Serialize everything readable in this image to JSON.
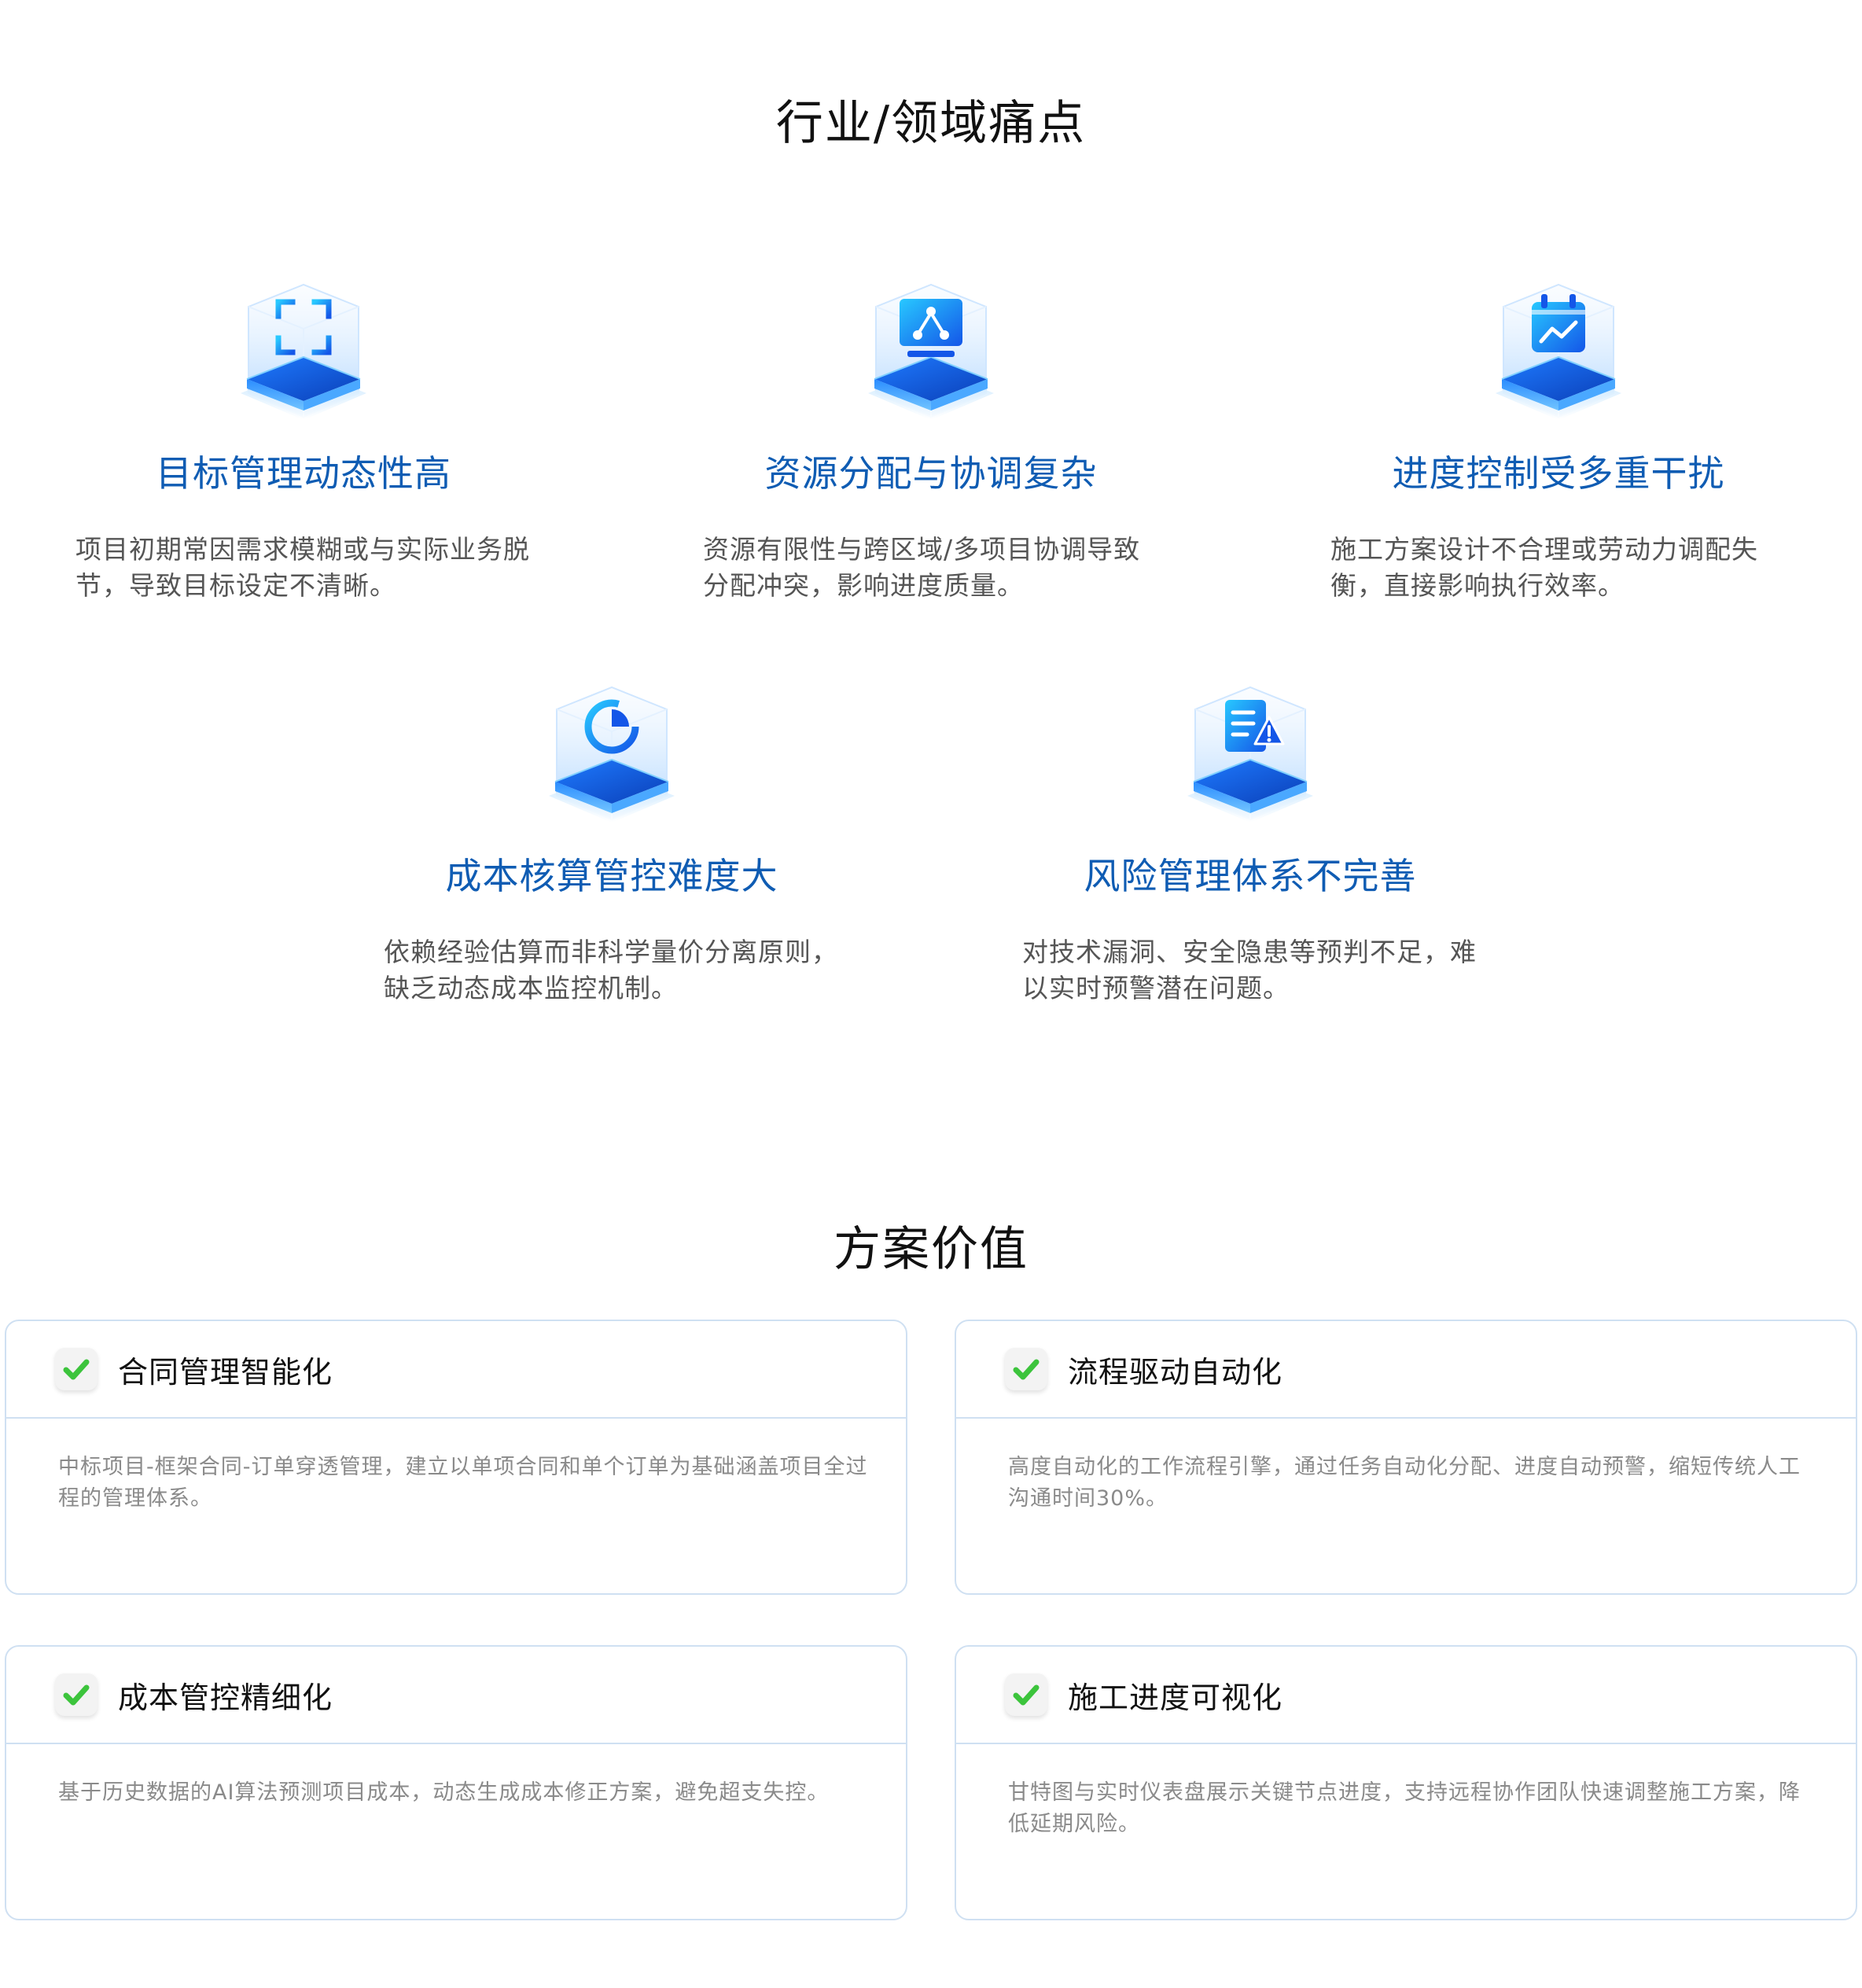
{
  "pain_section": {
    "title": "行业/领域痛点",
    "cards": [
      {
        "icon": "scan-frame-icon",
        "title": "目标管理动态性高",
        "desc": "项目初期常因需求模糊或与实际业务脱节，导致目标设定不清晰。"
      },
      {
        "icon": "network-monitor-icon",
        "title": "资源分配与协调复杂",
        "desc": "资源有限性与跨区域/多项目协调导致分配冲突，影响进度质量。"
      },
      {
        "icon": "calendar-chart-icon",
        "title": "进度控制受多重干扰",
        "desc": "施工方案设计不合理或劳动力调配失衡，直接影响执行效率。"
      },
      {
        "icon": "pie-chart-icon",
        "title": "成本核算管控难度大",
        "desc": "依赖经验估算而非科学量价分离原则，缺乏动态成本监控机制。"
      },
      {
        "icon": "document-warning-icon",
        "title": "风险管理体系不完善",
        "desc": "对技术漏洞、安全隐患等预判不足，难以实时预警潜在问题。"
      }
    ]
  },
  "value_section": {
    "title": "方案价值",
    "cards": [
      {
        "title": "合同管理智能化",
        "desc": "中标项目-框架合同-订单穿透管理，建立以单项合同和单个订单为基础涵盖项目全过程的管理体系。"
      },
      {
        "title": "流程驱动自动化",
        "desc": "高度自动化的工作流程引擎，通过任务自动化分配、进度自动预警，缩短传统人工沟通时间30%。"
      },
      {
        "title": "成本管控精细化",
        "desc": "基于历史数据的AI算法预测项目成本，动态生成成本修正方案，避免超支失控。"
      },
      {
        "title": "施工进度可视化",
        "desc": "甘特图与实时仪表盘展示关键节点进度，支持远程协作团队快速调整施工方案，降低延期风险。"
      }
    ]
  },
  "colors": {
    "accent_blue": "#0f5cb3",
    "icon_blue": "#1677ff",
    "check_green": "#3cc43c",
    "card_border": "#cfe0f2"
  }
}
